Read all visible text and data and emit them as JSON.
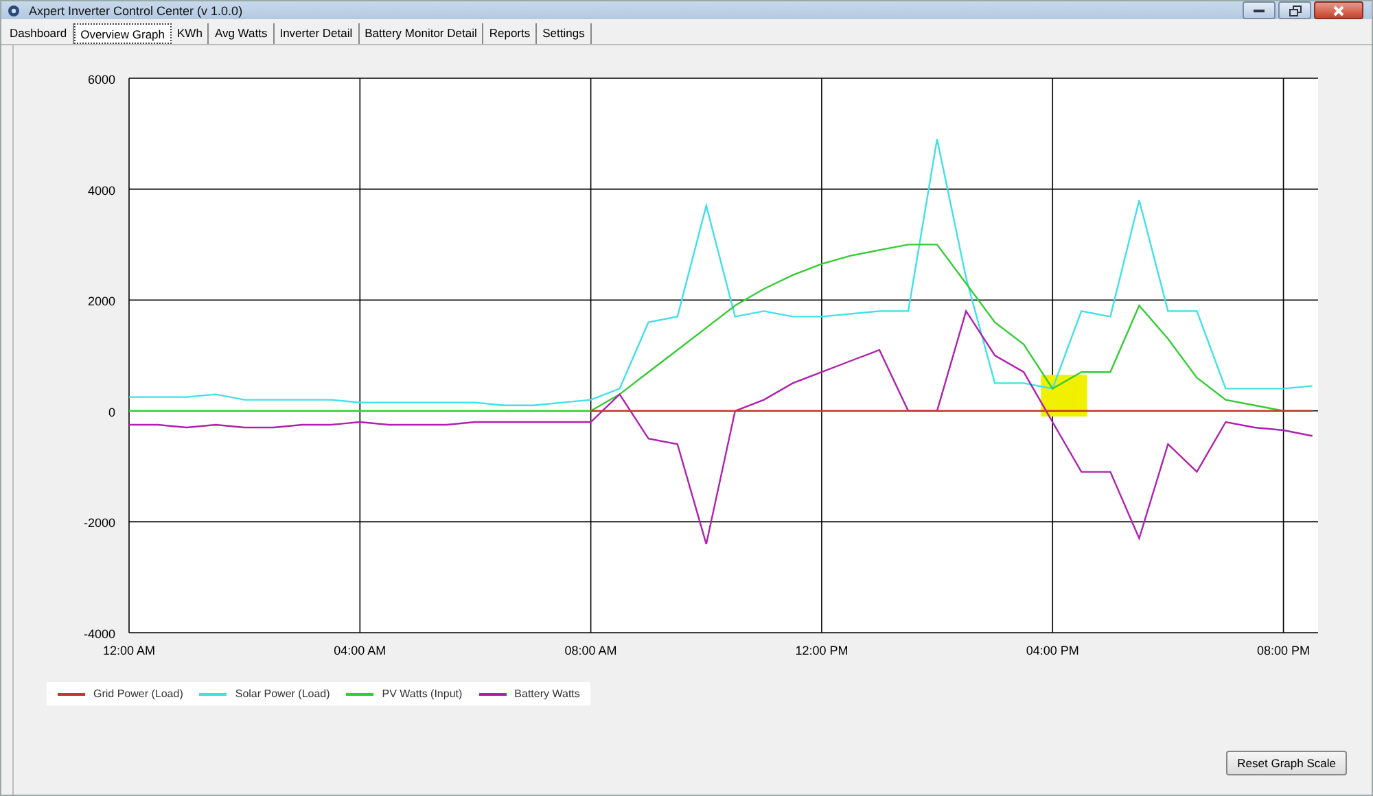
{
  "window": {
    "title": "Axpert Inverter Control Center  (v 1.0.0)"
  },
  "tabs": [
    {
      "label": "Dashboard",
      "selected": false
    },
    {
      "label": "Overview Graph",
      "selected": true
    },
    {
      "label": "KWh",
      "selected": false
    },
    {
      "label": "Avg Watts",
      "selected": false
    },
    {
      "label": "Inverter Detail",
      "selected": false
    },
    {
      "label": "Battery Monitor Detail",
      "selected": false
    },
    {
      "label": "Reports",
      "selected": false
    },
    {
      "label": "Settings",
      "selected": false
    }
  ],
  "graph": {
    "chart_data": {
      "type": "line",
      "x": [
        0,
        0.5,
        1,
        1.5,
        2,
        2.5,
        3,
        3.5,
        4,
        4.5,
        5,
        5.5,
        6,
        6.5,
        7,
        7.5,
        8,
        8.5,
        9,
        9.5,
        10,
        10.5,
        11,
        11.5,
        12,
        12.5,
        13,
        13.5,
        14,
        14.5,
        15,
        15.5,
        16,
        16.5,
        17,
        17.5,
        18,
        18.5,
        19,
        19.5,
        20,
        20.5
      ],
      "series": [
        {
          "name": "Grid Power (Load)",
          "color": "#c0392b",
          "values": [
            null,
            null,
            null,
            null,
            null,
            null,
            null,
            null,
            null,
            null,
            null,
            null,
            null,
            null,
            null,
            null,
            0,
            0,
            0,
            0,
            0,
            0,
            0,
            0,
            0,
            0,
            0,
            0,
            0,
            0,
            0,
            0,
            0,
            0,
            0,
            0,
            0,
            0,
            0,
            0,
            0,
            0
          ]
        },
        {
          "name": "Solar Power (Load)",
          "color": "#40e0e8",
          "values": [
            250,
            250,
            250,
            300,
            200,
            200,
            200,
            200,
            150,
            150,
            150,
            150,
            150,
            100,
            100,
            150,
            200,
            400,
            1600,
            1700,
            3700,
            1700,
            1800,
            1700,
            1700,
            1750,
            1800,
            1800,
            4900,
            2400,
            500,
            500,
            400,
            1800,
            1700,
            3800,
            1800,
            1800,
            400,
            400,
            400,
            450
          ]
        },
        {
          "name": "PV Watts (Input)",
          "color": "#33cc33",
          "values": [
            0,
            0,
            0,
            0,
            0,
            0,
            0,
            0,
            0,
            0,
            0,
            0,
            0,
            0,
            0,
            0,
            0,
            300,
            700,
            1100,
            1500,
            1900,
            2200,
            2450,
            2650,
            2800,
            2900,
            3000,
            3000,
            2300,
            1600,
            1200,
            400,
            700,
            700,
            1900,
            1300,
            600,
            200,
            100,
            0,
            0
          ]
        },
        {
          "name": "Battery Watts",
          "color": "#b020b0",
          "values": [
            -250,
            -250,
            -300,
            -250,
            -300,
            -300,
            -250,
            -250,
            -200,
            -250,
            -250,
            -250,
            -200,
            -200,
            -200,
            -200,
            -200,
            300,
            -500,
            -600,
            -2400,
            0,
            200,
            500,
            700,
            900,
            1100,
            0,
            0,
            1800,
            1000,
            700,
            -200,
            -1100,
            -1100,
            -2300,
            -600,
            -1100,
            -200,
            -300,
            -350,
            -450
          ]
        }
      ],
      "xlim": [
        0,
        20.6
      ],
      "ylim": [
        -4000,
        6000
      ],
      "xticks": [
        {
          "value": 0,
          "label": "12:00 AM"
        },
        {
          "value": 4,
          "label": "04:00 AM"
        },
        {
          "value": 8,
          "label": "08:00 AM"
        },
        {
          "value": 12,
          "label": "12:00 PM"
        },
        {
          "value": 16,
          "label": "04:00 PM"
        },
        {
          "value": 20,
          "label": "08:00 PM"
        }
      ],
      "yticks": [
        -4000,
        -2000,
        0,
        2000,
        4000,
        6000
      ],
      "grid": true,
      "bands": [
        {
          "axis": "x",
          "from": 15.8,
          "to": 16.6,
          "color": "#f0f000"
        }
      ]
    }
  },
  "buttons": [
    {
      "label": "Reset Graph Scale"
    }
  ]
}
